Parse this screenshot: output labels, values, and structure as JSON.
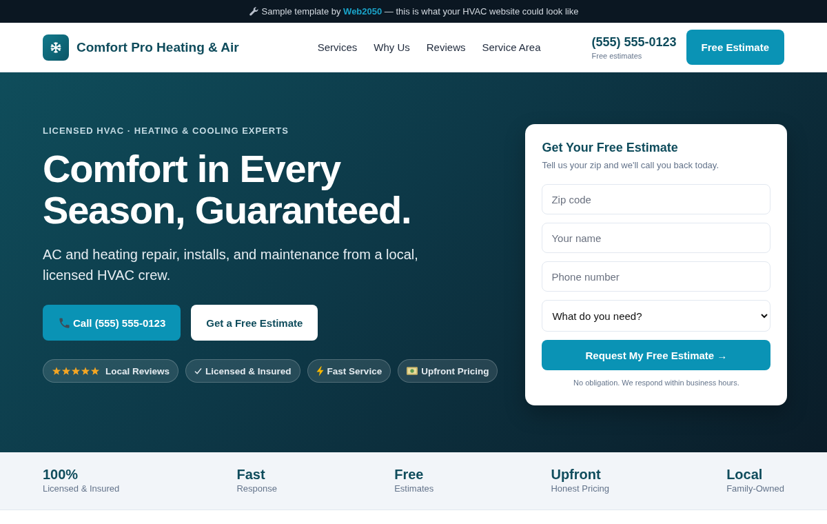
{
  "promo_bar": {
    "text_before": "Sample template by",
    "link": "Web2050",
    "text_after": "— this is what your HVAC website could look like"
  },
  "header": {
    "brand": "Comfort Pro Heating & Air",
    "nav": [
      "Services",
      "Why Us",
      "Reviews",
      "Service Area"
    ],
    "phone": "(555) 555-0123",
    "phone_note": "Free estimates",
    "cta": "Free Estimate"
  },
  "hero": {
    "eyebrow": "LICENSED HVAC · HEATING & COOLING EXPERTS",
    "title": "Comfort in Every Season, Guaranteed.",
    "subtitle": "AC and heating repair, installs, and maintenance from a local, licensed HVAC crew.",
    "buttons": [
      {
        "kind": "call",
        "label": "Call (555) 555-0123"
      },
      {
        "kind": "light",
        "label": "Get a Free Estimate"
      }
    ],
    "badges": [
      {
        "kind": "stars",
        "stars": 5,
        "label": "Local Reviews"
      },
      {
        "kind": "check",
        "label": "Licensed & Insured"
      },
      {
        "kind": "bolt",
        "label": "Fast Service"
      },
      {
        "kind": "cash",
        "label": "Upfront Pricing"
      }
    ]
  },
  "estimate_form": {
    "title": "Get Your Free Estimate",
    "subtitle": "Tell us your zip and we'll call you back today.",
    "fields": [
      {
        "kind": "input",
        "placeholder": "Zip code"
      },
      {
        "kind": "input",
        "placeholder": "Your name"
      },
      {
        "kind": "input",
        "placeholder": "Phone number"
      },
      {
        "kind": "select",
        "value": "What do you need?"
      }
    ],
    "submit": "Request My Free Estimate →",
    "note": "No obligation. We respond within business hours."
  },
  "stats": [
    {
      "value": "100%",
      "label": "Licensed & Insured"
    },
    {
      "value": "Fast",
      "label": "Response"
    },
    {
      "value": "Free",
      "label": "Estimates"
    },
    {
      "value": "Upfront",
      "label": "Honest Pricing"
    },
    {
      "value": "Local",
      "label": "Family-Owned"
    }
  ]
}
